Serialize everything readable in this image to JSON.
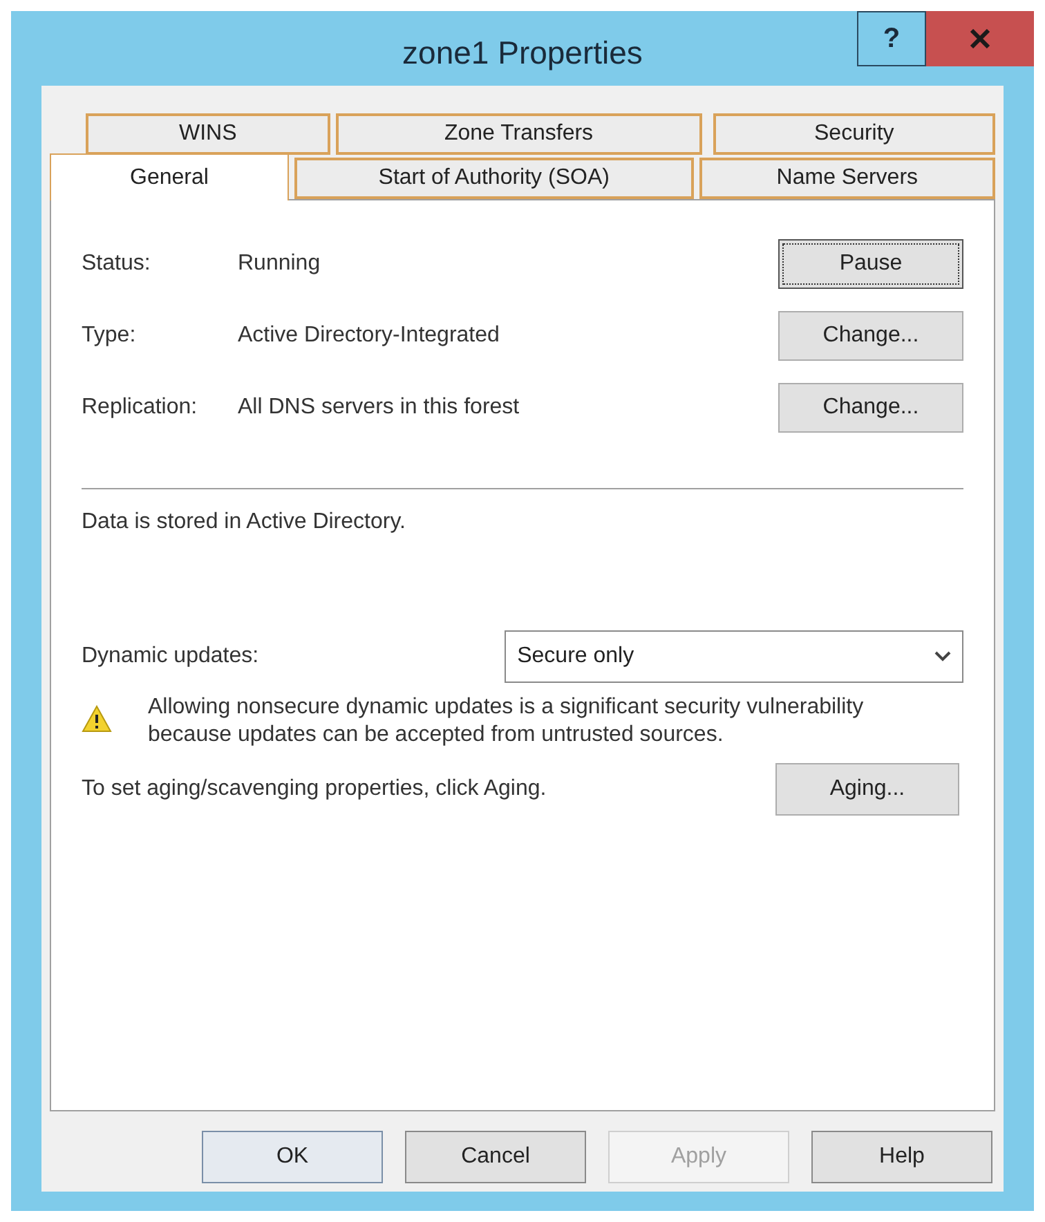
{
  "window": {
    "title": "zone1 Properties",
    "help_button": "?"
  },
  "tab_rows": [
    {
      "tabs": [
        {
          "label": "WINS",
          "selected": false
        },
        {
          "label": "Zone Transfers",
          "selected": false
        },
        {
          "label": "Security",
          "selected": false
        }
      ]
    },
    {
      "tabs": [
        {
          "label": "General",
          "selected": true
        },
        {
          "label": "Start of Authority (SOA)",
          "selected": false
        },
        {
          "label": "Name Servers",
          "selected": false
        }
      ]
    }
  ],
  "fields": [
    {
      "label": "Status:",
      "value": "Running",
      "button": {
        "label": "Pause",
        "focused": true
      }
    },
    {
      "label": "Type:",
      "value": "Active Directory-Integrated",
      "button": {
        "label": "Change...",
        "focused": false
      }
    },
    {
      "label": "Replication:",
      "value": "All DNS servers in this forest",
      "button": {
        "label": "Change...",
        "focused": false
      }
    }
  ],
  "note": "Data is stored in Active Directory.",
  "dynamic_updates": {
    "label": "Dynamic updates:",
    "value": "Secure only"
  },
  "warning": "Allowing nonsecure dynamic updates is a significant security vulnerability because updates can be accepted from untrusted sources.",
  "aging": {
    "text": "To set aging/scavenging properties, click Aging.",
    "button": "Aging..."
  },
  "footer_buttons": [
    {
      "label": "OK",
      "default": true,
      "disabled": false
    },
    {
      "label": "Cancel",
      "default": false,
      "disabled": false
    },
    {
      "label": "Apply",
      "default": false,
      "disabled": true
    },
    {
      "label": "Help",
      "default": false,
      "disabled": false
    }
  ]
}
